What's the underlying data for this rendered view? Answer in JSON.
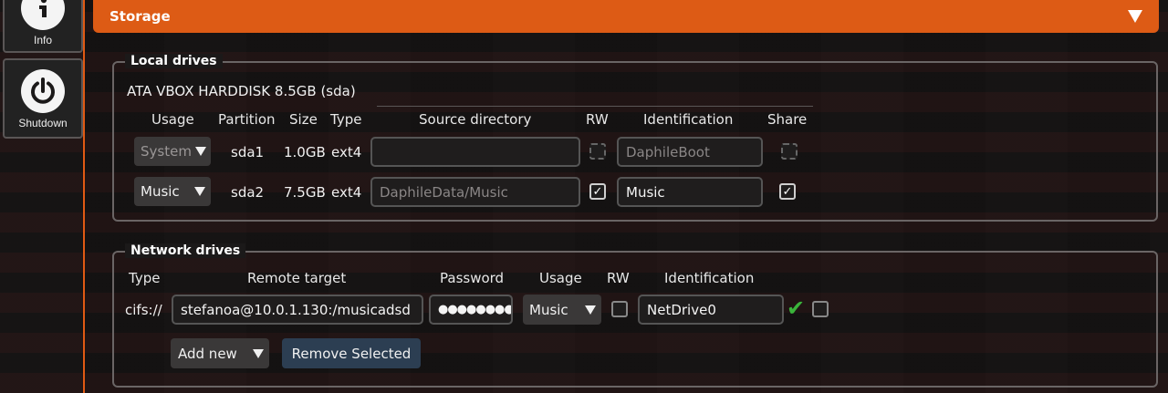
{
  "sidebar": {
    "info_label": "Info",
    "shutdown_label": "Shutdown"
  },
  "header": {
    "title": "Storage"
  },
  "local": {
    "legend": "Local drives",
    "disk_title": "ATA VBOX HARDDISK 8.5GB (sda)",
    "columns": [
      "Usage",
      "Partition",
      "Size",
      "Type",
      "Source directory",
      "RW",
      "Identification",
      "Share"
    ],
    "rows": [
      {
        "usage": "System",
        "partition": "sda1",
        "size": "1.0GB",
        "type": "ext4",
        "source": "",
        "identification": "DaphileBoot"
      },
      {
        "usage": "Music",
        "partition": "sda2",
        "size": "7.5GB",
        "type": "ext4",
        "source": "DaphileData/Music",
        "identification": "Music"
      }
    ]
  },
  "network": {
    "legend": "Network drives",
    "columns": [
      "Type",
      "Remote target",
      "Password",
      "Usage",
      "RW",
      "Identification"
    ],
    "row": {
      "type": "cifs://",
      "remote": "stefanoa@10.0.1.130:/musicadsd",
      "password": "●●●●●●●●",
      "usage": "Music",
      "identification": "NetDrive0"
    },
    "add_new_label": "Add new",
    "remove_label": "Remove Selected"
  },
  "colors": {
    "accent": "#dd5b15",
    "ok": "#3bb43b"
  },
  "icons": [
    "info-icon",
    "power-icon",
    "chevron-down-icon",
    "check-icon"
  ]
}
